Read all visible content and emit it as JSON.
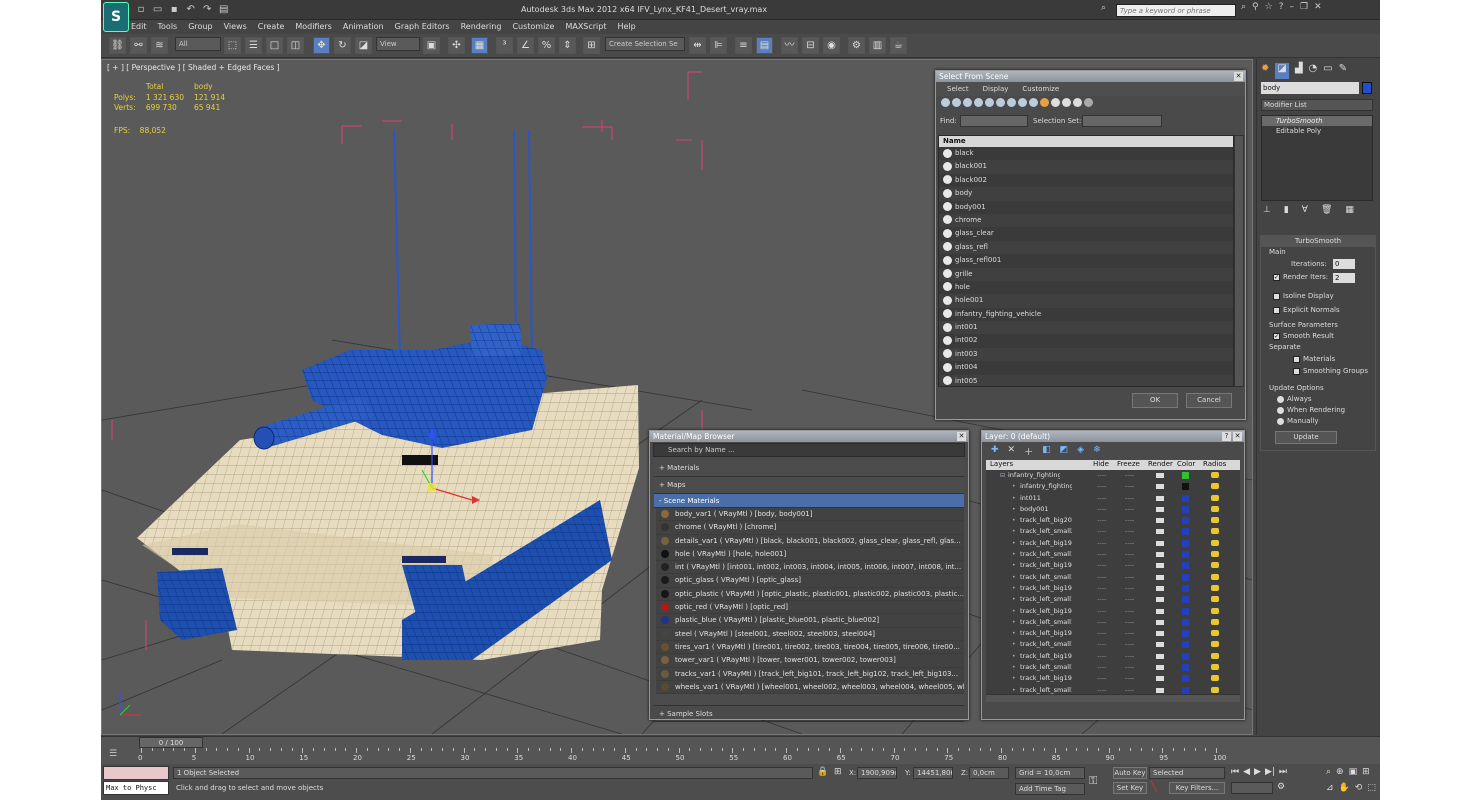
{
  "app": {
    "title": "Autodesk 3ds Max  2012 x64     IFV_Lynx_KF41_Desert_vray.max",
    "search_placeholder": "Type a keyword or phrase",
    "menu": [
      "Edit",
      "Tools",
      "Group",
      "Views",
      "Create",
      "Modifiers",
      "Animation",
      "Graph Editors",
      "Rendering",
      "Customize",
      "MAXScript",
      "Help"
    ]
  },
  "toolbar": {
    "filter_dropdown": "All",
    "ref_coord_dropdown": "View",
    "named_selection": "Create Selection Se"
  },
  "viewport": {
    "label": "[ + ] [ Perspective ] [ Shaded + Edged Faces ]",
    "stats_header_total": "Total",
    "stats_header_body": "body",
    "polys_label": "Polys:",
    "polys_total": "1 321 630",
    "polys_body": "121 914",
    "verts_label": "Verts:",
    "verts_total": "699 730",
    "verts_body": "65 941",
    "fps_label": "FPS:",
    "fps_value": "88,052"
  },
  "select_from_scene": {
    "title": "Select From Scene",
    "menus": [
      "Select",
      "Display",
      "Customize"
    ],
    "find_label": "Find:",
    "selection_set_label": "Selection Set:",
    "column_name": "Name",
    "items": [
      "black",
      "black001",
      "black002",
      "body",
      "body001",
      "chrome",
      "glass_clear",
      "glass_refl",
      "glass_refl001",
      "grille",
      "hole",
      "hole001",
      "infantry_fighting_vehicle",
      "int001",
      "int002",
      "int003",
      "int004",
      "int005"
    ],
    "ok": "OK",
    "cancel": "Cancel"
  },
  "material_browser": {
    "title": "Material/Map Browser",
    "search_placeholder": "Search by Name ...",
    "categories": [
      "+ Materials",
      "+ Maps",
      "- Scene Materials"
    ],
    "materials": [
      {
        "text": "body_var1  ( VRayMtl )  [body, body001]",
        "color": "#8a6a3a"
      },
      {
        "text": "chrome  ( VRayMtl )  [chrome]",
        "color": "#333333"
      },
      {
        "text": "details_var1  ( VRayMtl )  [black, black001, black002, glass_clear, glass_refl, glas...",
        "color": "#7a6040"
      },
      {
        "text": "hole  ( VRayMtl )  [hole, hole001]",
        "color": "#111111"
      },
      {
        "text": "int  ( VRayMtl )  [int001, int002, int003, int004, int005, int006, int007, int008, int...",
        "color": "#222222"
      },
      {
        "text": "optic_glass  ( VRayMtl )  [optic_glass]",
        "color": "#1a1a1a"
      },
      {
        "text": "optic_plastic  ( VRayMtl )  [optic_plastic, plastic001, plastic002, plastic003, plastic...",
        "color": "#151515"
      },
      {
        "text": "optic_red  ( VRayMtl )  [optic_red]",
        "color": "#b01818"
      },
      {
        "text": "plastic_blue  ( VRayMtl )  [plastic_blue001, plastic_blue002]",
        "color": "#22338a"
      },
      {
        "text": "steel  ( VRayMtl )  [steel001, steel002, steel003, steel004]",
        "color": "#444444"
      },
      {
        "text": "tires_var1  ( VRayMtl )  [tire001, tire002, tire003, tire004, tire005, tire006, tire00...",
        "color": "#6a5030"
      },
      {
        "text": "tower_var1  ( VRayMtl )  [tower, tower001, tower002, tower003]",
        "color": "#7a6040"
      },
      {
        "text": "tracks_var1  ( VRayMtl )  [track_left_big101, track_left_big102, track_left_big103...",
        "color": "#6a5a40"
      },
      {
        "text": "wheels_var1  ( VRayMtl )  [wheel001, wheel002, wheel003, wheel004, wheel005, wh...",
        "color": "#5a4a30"
      }
    ],
    "sample_slots": "+ Sample Slots"
  },
  "layer_manager": {
    "title": "Layer: 0 (default)",
    "columns": [
      "Layers",
      "Hide",
      "Freeze",
      "Render",
      "Color",
      "Radios"
    ],
    "layers": [
      "infantry_fighting_ve",
      "infantry_fighting",
      "int011",
      "body001",
      "track_left_big20",
      "track_left_small2",
      "track_left_big19",
      "track_left_small1",
      "track_left_big19",
      "track_left_small1",
      "track_left_big19",
      "track_left_small1",
      "track_left_big19",
      "track_left_small1",
      "track_left_big19",
      "track_left_small1",
      "track_left_big19",
      "track_left_small1",
      "track_left_big19",
      "track_left_small1"
    ],
    "hide_marker": "----",
    "freeze_marker": "----"
  },
  "command_panel": {
    "object_name": "body",
    "modifier_list": "Modifier List",
    "stack": [
      "TurboSmooth",
      "Editable Poly"
    ],
    "rollout_title": "TurboSmooth",
    "main_label": "Main",
    "iterations_label": "Iterations:",
    "iterations_value": "0",
    "render_iters_label": "Render Iters:",
    "render_iters_value": "2",
    "isoline_display": "Isoline Display",
    "explicit_normals": "Explicit Normals",
    "surface_params": "Surface Parameters",
    "smooth_result": "Smooth Result",
    "separate_label": "Separate",
    "materials_label": "Materials",
    "smoothing_groups": "Smoothing Groups",
    "update_options": "Update Options",
    "always": "Always",
    "when_rendering": "When Rendering",
    "manually": "Manually",
    "update_button": "Update"
  },
  "timeline": {
    "frame_display": "0 / 100",
    "ticks": [
      "0",
      "5",
      "10",
      "15",
      "20",
      "25",
      "30",
      "35",
      "40",
      "45",
      "50",
      "55",
      "60",
      "65",
      "70",
      "75",
      "80",
      "85",
      "90",
      "95",
      "100"
    ]
  },
  "status": {
    "listener": "Max to Physc",
    "selected": "1 Object Selected",
    "prompt": "Click and drag to select and move objects",
    "x_label": "X:",
    "x_value": "1900,909c",
    "y_label": "Y:",
    "y_value": "14451,806",
    "z_label": "Z:",
    "z_value": "0,0cm",
    "grid": "Grid = 10,0cm",
    "add_time_tag": "Add Time Tag",
    "auto_key": "Auto Key",
    "set_key": "Set Key",
    "selected_dropdown": "Selected",
    "key_filters": "Key Filters..."
  }
}
